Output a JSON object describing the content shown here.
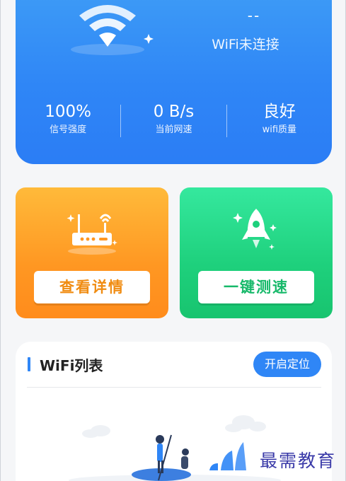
{
  "status": {
    "ssid": "--",
    "state": "WiFi未连接",
    "stats": [
      {
        "value": "100%",
        "label": "信号强度"
      },
      {
        "value": "0 B/s",
        "label": "当前网速"
      },
      {
        "value": "良好",
        "label": "wifi质量"
      }
    ]
  },
  "actions": {
    "details_label": "查看详情",
    "speed_label": "一键测速"
  },
  "wifi_list": {
    "title": "WiFi列表",
    "locate_label": "开启定位"
  },
  "watermark": "最需教育",
  "colors": {
    "primary": "#2f86f6",
    "orange": "#ff9722",
    "green": "#1ed07c"
  },
  "icons": {
    "header": "wifi-icon",
    "details": "router-icon",
    "speed": "rocket-icon",
    "empty": "boat-illustration"
  }
}
